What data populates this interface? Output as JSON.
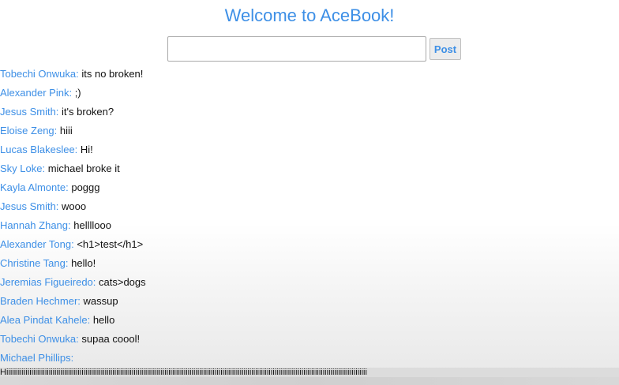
{
  "header": {
    "title": "Welcome to AceBook!"
  },
  "composer": {
    "input_value": "",
    "placeholder": "",
    "button_label": "Post"
  },
  "feed": [
    {
      "author": "Tobechi Onwuka:",
      "message": "its no broken!"
    },
    {
      "author": "Alexander Pink:",
      "message": ";)"
    },
    {
      "author": "Jesus Smith:",
      "message": "it's broken?"
    },
    {
      "author": "Eloise Zeng:",
      "message": "hiii"
    },
    {
      "author": "Lucas Blakeslee:",
      "message": "Hi!"
    },
    {
      "author": "Sky Loke:",
      "message": "michael broke it"
    },
    {
      "author": "Kayla Almonte:",
      "message": "poggg"
    },
    {
      "author": "Jesus Smith:",
      "message": "wooo"
    },
    {
      "author": "Hannah Zhang:",
      "message": "hellllooo"
    },
    {
      "author": "Alexander Tong:",
      "message": "<h1>test</h1>"
    },
    {
      "author": "Christine Tang:",
      "message": "hello!"
    },
    {
      "author": "Jeremias Figueiredo:",
      "message": "cats>dogs"
    },
    {
      "author": "Braden Hechmer:",
      "message": "wassup"
    },
    {
      "author": "Alea Pindat Kahele:",
      "message": "hello"
    },
    {
      "author": "Tobechi Onwuka:",
      "message": "supaa coool!"
    },
    {
      "author": "Michael Phillips:",
      "message": ""
    }
  ],
  "overflow_text": "Hiiiiiiiiiiiiiiiiiiiiiiiiiiiiiiiiiiiiiiiiiiiiiiiiiiiiiiiiiiiiiiiiiiiiiiiiiiiiiiiiiiiiiiiiiiiiiiiiiiiiiiiiiiiiiiiiiiiiiiiiiiiiiiiiiiiiiiiiiiiiiiiiiiiiiiiiiiiiiiiiiiiiiiiiiiiiiiiiiiiiiiiiiii",
  "colors": {
    "accent": "#3d8fe6"
  }
}
